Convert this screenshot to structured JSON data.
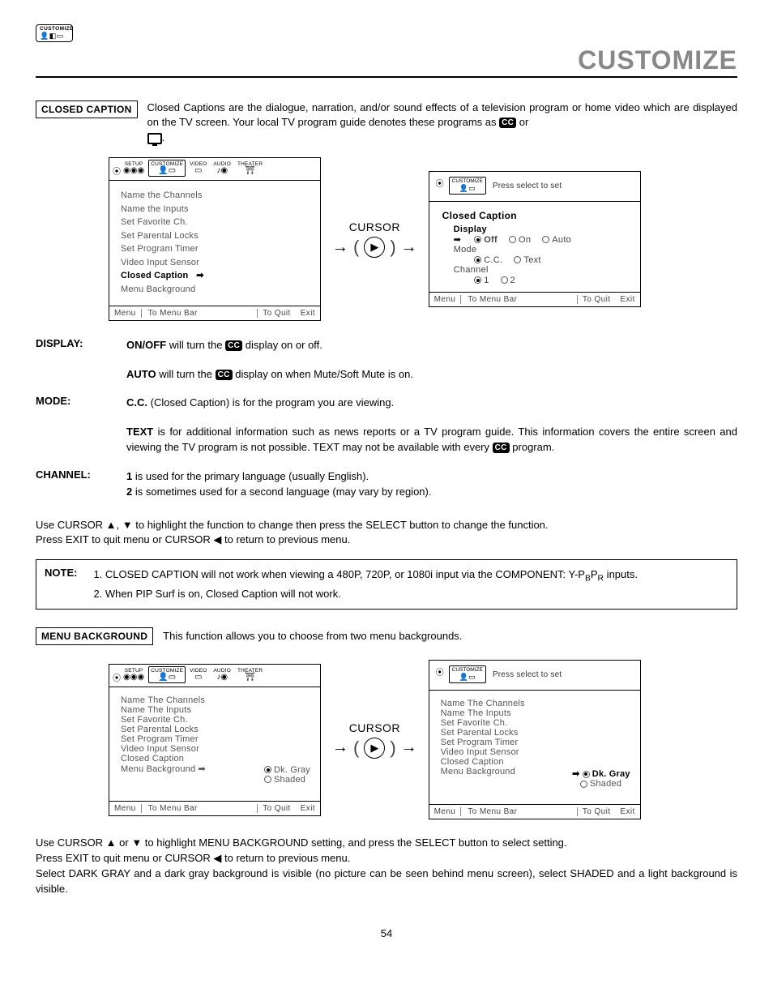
{
  "header": {
    "badge": "CUSTOMIZE",
    "title": "CUSTOMIZE"
  },
  "cc": {
    "label": "CLOSED CAPTION",
    "intro_a": "Closed Captions are the dialogue, narration, and/or sound effects of a television program or home video which are displayed on the TV screen.  Your local TV program guide denotes these programs as ",
    "intro_b": " or ",
    "intro_c": "."
  },
  "tabs": [
    "SETUP",
    "CUSTOMIZE",
    "VIDEO",
    "AUDIO",
    "THEATER"
  ],
  "panel1": {
    "items": [
      "Name the Channels",
      "Name the Inputs",
      "Set Favorite Ch.",
      "Set Parental Locks",
      "Set Program Timer",
      "Video Input Sensor",
      "Closed Caption",
      "Menu Background"
    ],
    "selected": "Closed Caption",
    "footer": {
      "l": "Menu",
      "m": "To Menu Bar",
      "r": "To Quit",
      "x": "Exit"
    }
  },
  "cursor": "CURSOR",
  "panel2": {
    "hint": "Press select to set",
    "title": "Closed Caption",
    "display": {
      "label": "Display",
      "opts": [
        "Off",
        "On",
        "Auto"
      ],
      "sel": 0
    },
    "mode": {
      "label": "Mode",
      "opts": [
        "C.C.",
        "Text"
      ],
      "sel": 0
    },
    "channel": {
      "label": "Channel",
      "opts": [
        "1",
        "2"
      ],
      "sel": 0
    },
    "footer": {
      "l": "Menu",
      "m": "To Menu Bar",
      "r": "To Quit",
      "x": "Exit"
    }
  },
  "defs": {
    "display": {
      "label": "DISPLAY:",
      "onoff_b": "ON/OFF",
      "onoff": " will turn the ",
      "onoff2": " display on or off.",
      "auto_b": "AUTO",
      "auto": " will turn the ",
      "auto2": " display on when Mute/Soft Mute is on."
    },
    "mode": {
      "label": "MODE:",
      "cc_b": "C.C.",
      "cc": " (Closed Caption) is for the program you are viewing.",
      "text_b": "TEXT",
      "text": " is for additional information such as news reports or a TV program guide.  This information covers the entire screen and viewing the TV program is not possible.  TEXT may not be available with every ",
      "text2": " program."
    },
    "channel": {
      "label": "CHANNEL:",
      "l1a": "1",
      "l1b": " is used for the primary language (usually English).",
      "l2a": "2",
      "l2b": " is sometimes used for a second language (may vary by region)."
    }
  },
  "instr1a": "Use CURSOR ▲, ▼ to highlight the function to change then press the SELECT button to change the function.",
  "instr1b": "Press EXIT to quit menu or CURSOR ◀ to return to previous menu.",
  "note": {
    "label": "NOTE:",
    "l1": "1.  CLOSED CAPTION will not work when viewing a 480P, 720P, or 1080i input via the COMPONENT: Y-P",
    "l1b": " inputs.",
    "l2": "2.  When PIP Surf is on, Closed Caption will not work."
  },
  "mb": {
    "label": "MENU BACKGROUND",
    "intro": "This function allows you to choose from two menu backgrounds."
  },
  "panel3": {
    "items": [
      "Name The Channels",
      "Name The Inputs",
      "Set Favorite Ch.",
      "Set Parental Locks",
      "Set Program Timer",
      "Video Input Sensor",
      "Closed Caption",
      "Menu Background"
    ],
    "selected": "Menu Background",
    "opts": [
      "Dk. Gray",
      "Shaded"
    ],
    "sel": 0,
    "footer": {
      "l": "Menu",
      "m": "To Menu Bar",
      "r": "To Quit",
      "x": "Exit"
    }
  },
  "panel4": {
    "hint": "Press select to set",
    "items": [
      "Name The Channels",
      "Name The Inputs",
      "Set Favorite Ch.",
      "Set Parental Locks",
      "Set Program Timer",
      "Video Input Sensor",
      "Closed Caption",
      "Menu Background"
    ],
    "selected": "Menu Background",
    "opts": [
      "Dk. Gray",
      "Shaded"
    ],
    "sel": 0,
    "footer": {
      "l": "Menu",
      "m": "To Menu Bar",
      "r": "To Quit",
      "x": "Exit"
    }
  },
  "instr2a": "Use CURSOR ▲ or ▼ to highlight MENU BACKGROUND setting, and press the SELECT button to select setting.",
  "instr2b": "Press EXIT to quit menu or CURSOR ◀ to return to previous menu.",
  "instr2c": "Select DARK GRAY and a dark gray background is visible (no picture can be seen behind menu screen), select SHADED and a light background is visible.",
  "pagenum": "54"
}
